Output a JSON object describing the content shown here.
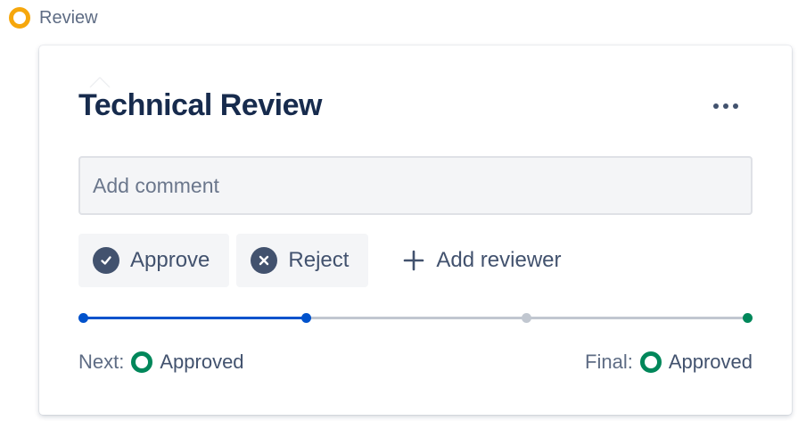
{
  "status": {
    "label": "Review",
    "color": "#f6a70c",
    "icon": "status-circle-icon"
  },
  "card": {
    "title": "Technical Review",
    "more_icon": "more-horizontal-icon",
    "comment": {
      "placeholder": "Add comment",
      "value": ""
    },
    "actions": {
      "approve": {
        "label": "Approve",
        "icon": "check-circle-icon"
      },
      "reject": {
        "label": "Reject",
        "icon": "cross-circle-icon"
      },
      "add_reviewer": {
        "label": "Add reviewer",
        "icon": "plus-icon"
      }
    },
    "progress": {
      "steps": 4,
      "current_step": 2,
      "active_color": "#0052cc",
      "inactive_color": "#c1c7d0",
      "final_color": "#00875a"
    },
    "footer": {
      "next_label": "Next:",
      "next_status": "Approved",
      "final_label": "Final:",
      "final_status": "Approved",
      "status_color": "#00875a"
    }
  }
}
